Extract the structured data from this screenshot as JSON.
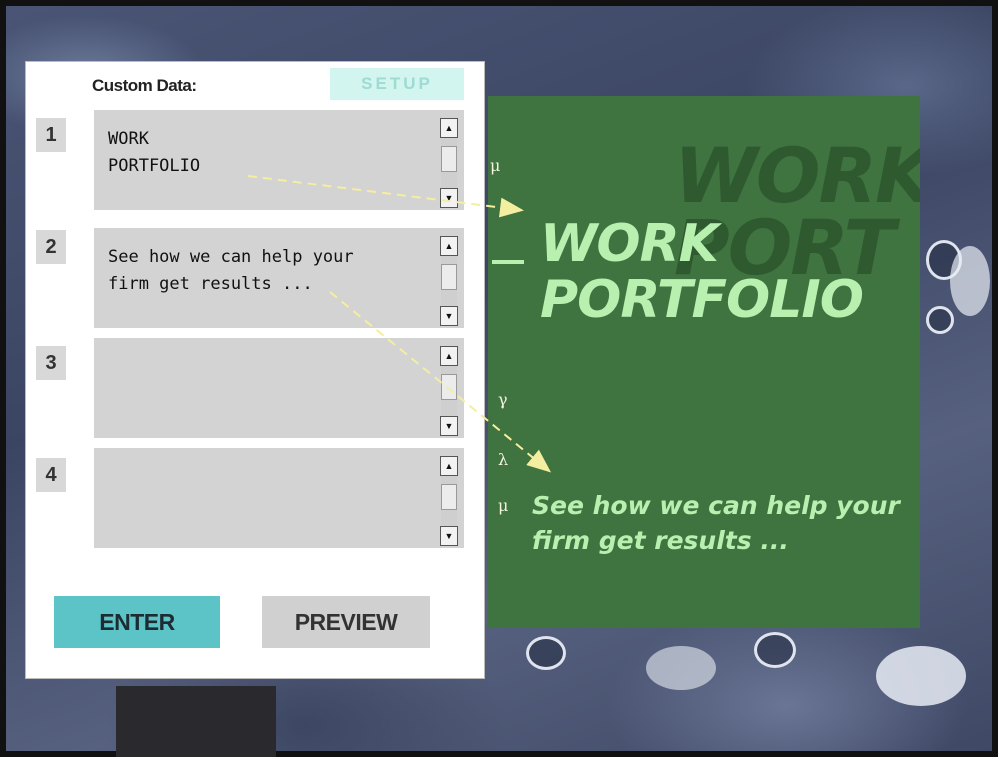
{
  "panel": {
    "label": "Custom Data:",
    "setup_label": "SETUP",
    "fields": [
      {
        "number": "1",
        "value": "WORK\nPORTFOLIO"
      },
      {
        "number": "2",
        "value": "See how we can help your\nfirm get results ..."
      },
      {
        "number": "3",
        "value": ""
      },
      {
        "number": "4",
        "value": ""
      }
    ],
    "scroll_up_glyph": "▲",
    "scroll_down_glyph": "▼",
    "enter_label": "ENTER",
    "preview_label": "PREVIEW"
  },
  "board": {
    "watermark": "WORK\nPORT",
    "title": "WORK\nPORTFOLIO",
    "subtitle": "See how we can help your\nfirm get results ...",
    "greek": {
      "mu_top": "μ",
      "gamma": "γ",
      "lambda": "λ",
      "mu_bottom": "μ"
    }
  },
  "colors": {
    "board_green": "#3f7340",
    "board_text": "#b8f0b0",
    "enter_button": "#5cc4c6",
    "setup_button": "#d2f5f0",
    "field_gray": "#d3d3d3",
    "arrow_dash": "#f4eea0"
  }
}
